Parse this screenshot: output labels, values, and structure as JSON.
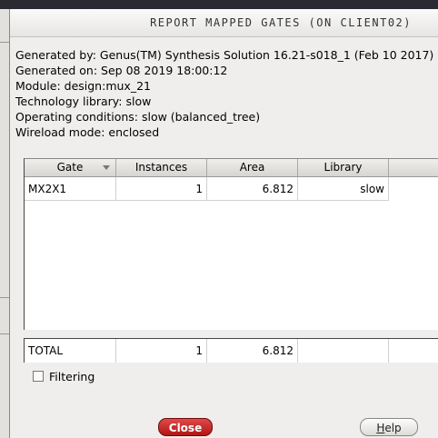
{
  "dialog": {
    "title": "Report Mapped Gates (on client02)"
  },
  "info": {
    "generated_by": "Generated by: Genus(TM) Synthesis Solution 16.21-s018_1 (Feb 10 2017)",
    "generated_on": "Generated on: Sep 08 2019 18:00:12",
    "module": "Module: design:mux_21",
    "technology_library": "Technology library: slow",
    "operating_conditions": "Operating conditions: slow (balanced_tree)",
    "wireload_mode": "Wireload mode: enclosed"
  },
  "table": {
    "columns": [
      "Gate",
      "Instances",
      "Area",
      "Library"
    ],
    "sort_column": "Gate",
    "rows": [
      {
        "gate": "MX2X1",
        "instances": "1",
        "area": "6.812",
        "library": "slow"
      }
    ],
    "total": {
      "label": "TOTAL",
      "instances": "1",
      "area": "6.812",
      "library": ""
    }
  },
  "filtering": {
    "label": "Filtering",
    "checked": false
  },
  "buttons": {
    "close": "Close",
    "help": "Help"
  },
  "colors": {
    "close_button": "#c62020",
    "dialog_bg": "#efeeec"
  }
}
